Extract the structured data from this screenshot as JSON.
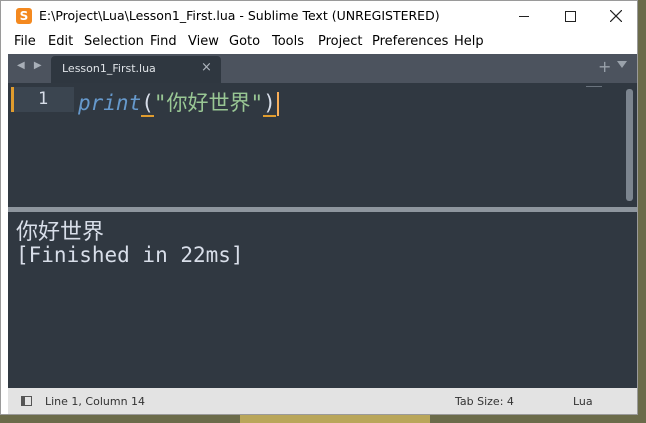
{
  "window": {
    "title": "E:\\Project\\Lua\\Lesson1_First.lua - Sublime Text (UNREGISTERED)",
    "app_icon_glyph": "S"
  },
  "menu": [
    "File",
    "Edit",
    "Selection",
    "Find",
    "View",
    "Goto",
    "Tools",
    "Project",
    "Preferences",
    "Help"
  ],
  "tabs": [
    {
      "label": "Lesson1_First.lua",
      "close": "×"
    }
  ],
  "tabbar": {
    "nav_arrows": "◀ ▶",
    "add": "+"
  },
  "editor": {
    "line_number": "1",
    "code": {
      "func": "print",
      "open": "(",
      "string": "\"你好世界\"",
      "close": ")"
    }
  },
  "output": {
    "line1": "你好世界",
    "line2": "[Finished in 22ms]"
  },
  "status": {
    "position": "Line 1, Column 14",
    "tab_size": "Tab Size: 4",
    "syntax": "Lua"
  },
  "colors": {
    "editor_bg": "#303841",
    "accent_orange": "#f9ae58",
    "keyword": "#6699cc",
    "string": "#99c794"
  }
}
